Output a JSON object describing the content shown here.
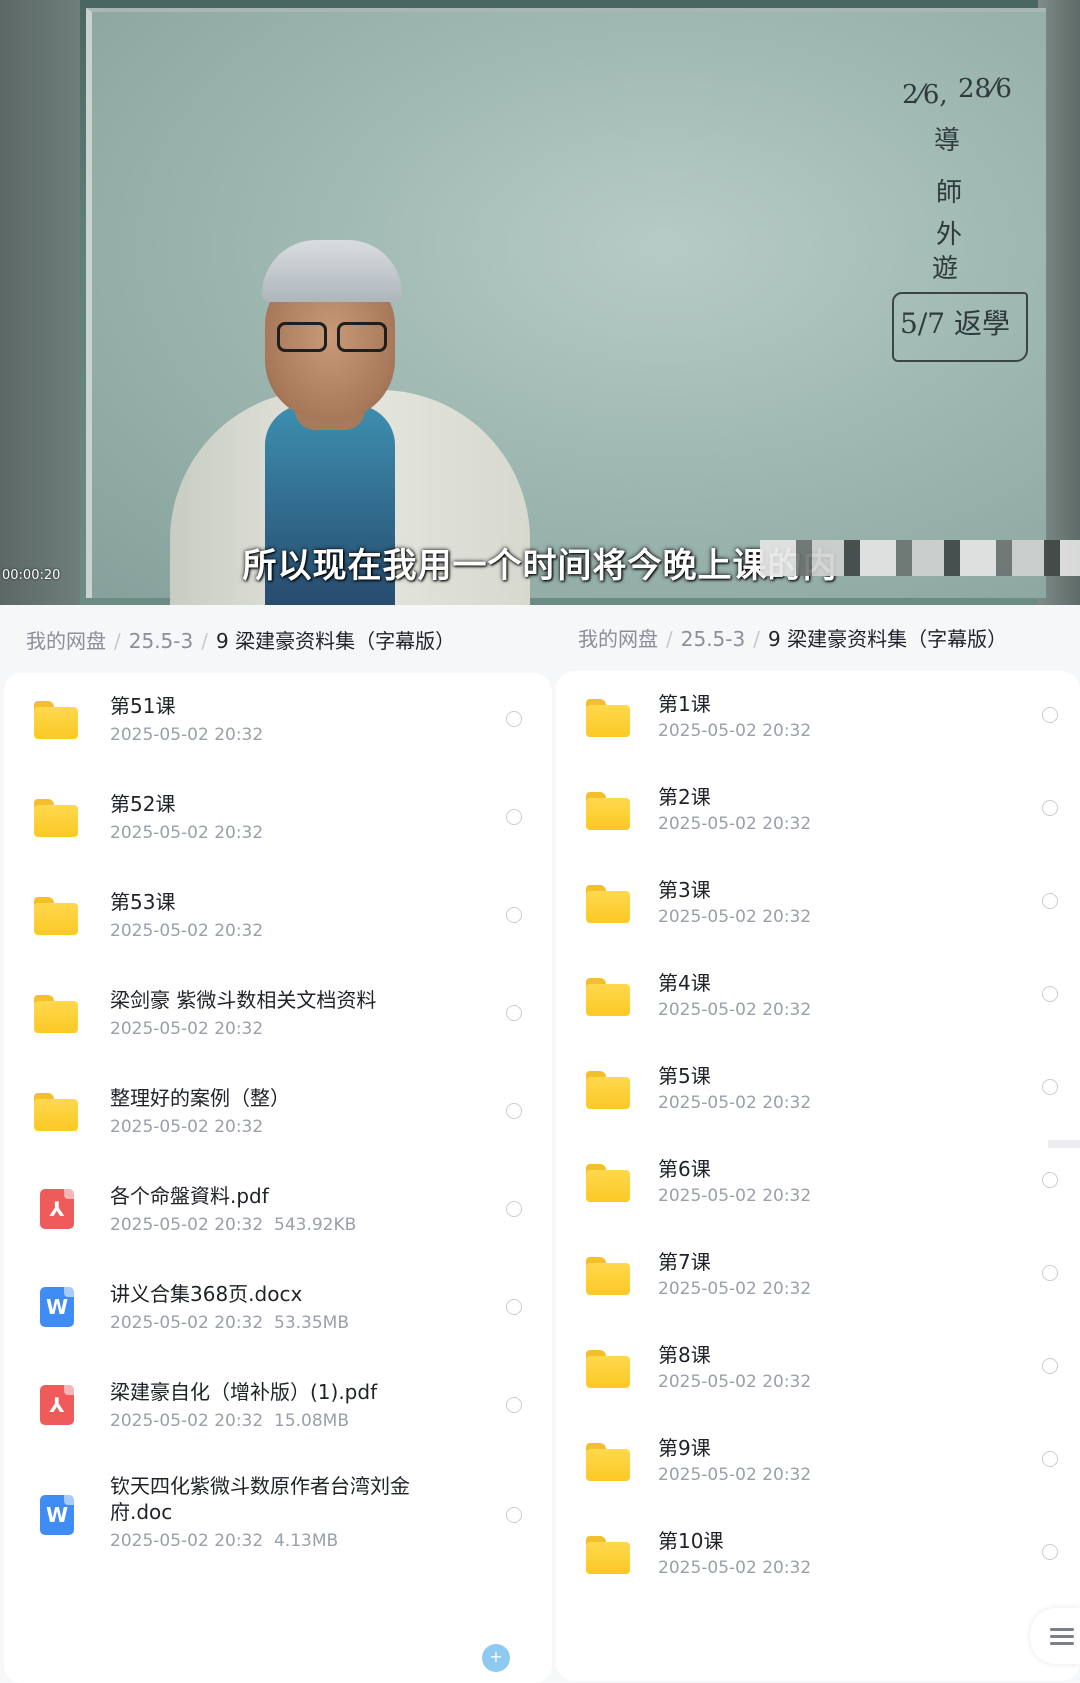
{
  "video": {
    "subtitle": "所以现在我用一个时间将今晚上课的内",
    "timecode": "00:00:20",
    "board_notes": [
      "2⁄6,",
      "28⁄6",
      "導",
      "師",
      "外",
      "遊",
      "5/7 返學"
    ]
  },
  "left_panel": {
    "breadcrumb": {
      "root": "我的网盘",
      "middle": "25.5-3",
      "current": "9 梁建豪资料集（字幕版）",
      "sep": "/"
    },
    "items": [
      {
        "type": "folder",
        "name": "第51课",
        "date": "2025-05-02  20:32",
        "size": ""
      },
      {
        "type": "folder",
        "name": "第52课",
        "date": "2025-05-02  20:32",
        "size": ""
      },
      {
        "type": "folder",
        "name": "第53课",
        "date": "2025-05-02  20:32",
        "size": ""
      },
      {
        "type": "folder",
        "name": "梁剑豪 紫微斗数相关文档资料",
        "date": "2025-05-02  20:32",
        "size": ""
      },
      {
        "type": "folder",
        "name": "整理好的案例（整）",
        "date": "2025-05-02  20:32",
        "size": ""
      },
      {
        "type": "pdf",
        "name": "各个命盤資料.pdf",
        "date": "2025-05-02  20:32",
        "size": "543.92KB"
      },
      {
        "type": "doc",
        "name": "讲义合集368页.docx",
        "date": "2025-05-02  20:32",
        "size": "53.35MB"
      },
      {
        "type": "pdf",
        "name": "梁建豪自化（增补版）(1).pdf",
        "date": "2025-05-02  20:32",
        "size": "15.08MB"
      },
      {
        "type": "doc",
        "name": "钦天四化紫微斗数原作者台湾刘金府.doc",
        "date": "2025-05-02  20:32",
        "size": "4.13MB"
      }
    ]
  },
  "right_panel": {
    "breadcrumb": {
      "root": "我的网盘",
      "middle": "25.5-3",
      "current": "9 梁建豪资料集（字幕版）",
      "sep": "/"
    },
    "items": [
      {
        "type": "folder",
        "name": "第1课",
        "date": "2025-05-02  20:32"
      },
      {
        "type": "folder",
        "name": "第2课",
        "date": "2025-05-02  20:32"
      },
      {
        "type": "folder",
        "name": "第3课",
        "date": "2025-05-02  20:32"
      },
      {
        "type": "folder",
        "name": "第4课",
        "date": "2025-05-02  20:32"
      },
      {
        "type": "folder",
        "name": "第5课",
        "date": "2025-05-02  20:32"
      },
      {
        "type": "folder",
        "name": "第6课",
        "date": "2025-05-02  20:32"
      },
      {
        "type": "folder",
        "name": "第7课",
        "date": "2025-05-02  20:32"
      },
      {
        "type": "folder",
        "name": "第8课",
        "date": "2025-05-02  20:32"
      },
      {
        "type": "folder",
        "name": "第9课",
        "date": "2025-05-02  20:32"
      },
      {
        "type": "folder",
        "name": "第10课",
        "date": "2025-05-02  20:32"
      }
    ]
  },
  "icons": {
    "folder": "folder-icon",
    "pdf": "pdf-file-icon",
    "doc": "word-file-icon",
    "fab": "plus-icon",
    "menu": "hamburger-menu-icon"
  },
  "colors": {
    "folder": "#fbc925",
    "pdf": "#ef5b5b",
    "doc": "#3f8cf5",
    "text": "#1f2329",
    "meta": "#9aa0aa"
  }
}
